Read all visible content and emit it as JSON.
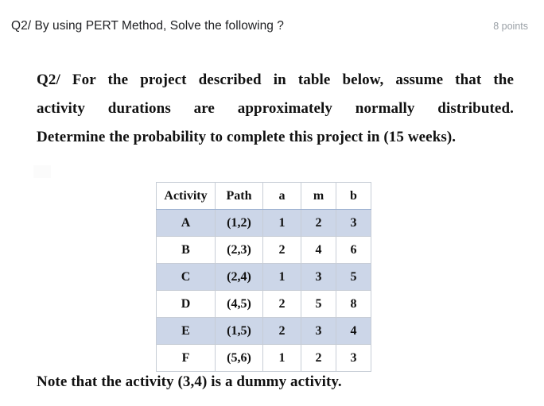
{
  "header": {
    "question_title": "Q2/ By using PERT Method, Solve the following ?",
    "points": "8 points"
  },
  "prompt": {
    "line1": "Q2/ For the project described in table below, assume that the",
    "line2": "activity durations are approximately normally distributed.",
    "line3": "Determine the probability to complete this project in (15 weeks)."
  },
  "table": {
    "columns": [
      "Activity",
      "Path",
      "a",
      "m",
      "b"
    ],
    "rows": [
      {
        "activity": "A",
        "path": "(1,2)",
        "a": "1",
        "m": "2",
        "b": "3"
      },
      {
        "activity": "B",
        "path": "(2,3)",
        "a": "2",
        "m": "4",
        "b": "6"
      },
      {
        "activity": "C",
        "path": "(2,4)",
        "a": "1",
        "m": "3",
        "b": "5"
      },
      {
        "activity": "D",
        "path": "(4,5)",
        "a": "2",
        "m": "5",
        "b": "8"
      },
      {
        "activity": "E",
        "path": "(1,5)",
        "a": "2",
        "m": "3",
        "b": "4"
      },
      {
        "activity": "F",
        "path": "(5,6)",
        "a": "1",
        "m": "2",
        "b": "3"
      }
    ]
  },
  "note": {
    "text": "Note that the activity (3,4) is a dummy activity."
  },
  "colors": {
    "shaded_row": "#ccd6e8",
    "table_border": "#c7cdd6",
    "title_text": "#202124",
    "points_text": "#9aa0a6",
    "body_text": "#111111"
  }
}
